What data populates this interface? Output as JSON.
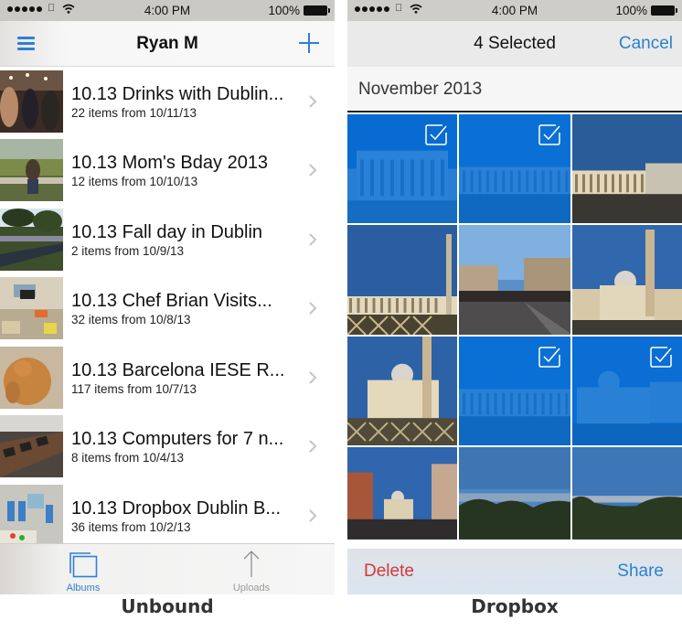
{
  "left": {
    "status_bar": {
      "time": "4:00 PM",
      "battery": "100%",
      "signal_icon": "signal-dots-icon",
      "carrier_icon": "apple-icon",
      "wifi_icon": "wifi-icon"
    },
    "nav": {
      "title": "Ryan M",
      "left_icon": "menu-icon",
      "right_icon": "plus-icon"
    },
    "albums": [
      {
        "title": "10.13 Drinks with Dublin...",
        "subtitle": "22 items from 10/11/13",
        "thumb": "people-at-bar"
      },
      {
        "title": "10.13 Mom's Bday 2013",
        "subtitle": "12 items from 10/10/13",
        "thumb": "child-on-bench"
      },
      {
        "title": "10.13 Fall day in Dublin",
        "subtitle": "2 items from 10/9/13",
        "thumb": "park-path"
      },
      {
        "title": "10.13 Chef Brian Visits...",
        "subtitle": "32 items from 10/8/13",
        "thumb": "office-lounge"
      },
      {
        "title": "10.13 Barcelona IESE R...",
        "subtitle": "117 items from 10/7/13",
        "thumb": "cat"
      },
      {
        "title": "10.13 Computers for 7 n...",
        "subtitle": "8 items from 10/4/13",
        "thumb": "laptops-on-table"
      },
      {
        "title": "10.13 Dropbox Dublin B...",
        "subtitle": "36 items from 10/2/13",
        "thumb": "group-in-office"
      }
    ],
    "tabs": [
      {
        "label": "Albums",
        "icon": "albums-icon",
        "active": true
      },
      {
        "label": "Uploads",
        "icon": "upload-arrow-icon",
        "active": false
      }
    ],
    "caption": "Unbound"
  },
  "right": {
    "status_bar": {
      "time": "4:00 PM",
      "battery": "100%"
    },
    "nav": {
      "title": "4 Selected",
      "cancel_label": "Cancel"
    },
    "section_header": "November 2013",
    "photos": [
      {
        "scene": "basilica-facade",
        "selected": true
      },
      {
        "scene": "colonnade-wide",
        "selected": true
      },
      {
        "scene": "colonnade-crowd",
        "selected": false
      },
      {
        "scene": "colonnade-fence",
        "selected": false
      },
      {
        "scene": "street-gap",
        "selected": false
      },
      {
        "scene": "basilica-obelisk",
        "selected": false
      },
      {
        "scene": "basilica-obelisk-fence",
        "selected": false
      },
      {
        "scene": "colonnade-wide",
        "selected": true
      },
      {
        "scene": "basilica-facade-2",
        "selected": true
      },
      {
        "scene": "via-conciliazione",
        "selected": false
      },
      {
        "scene": "city-view-trees",
        "selected": false
      },
      {
        "scene": "city-view-trees-2",
        "selected": false
      }
    ],
    "actions": {
      "delete_label": "Delete",
      "share_label": "Share"
    },
    "caption": "Dropbox"
  },
  "colors": {
    "accent_blue": "#2f7fd6",
    "delete_red": "#d8363c",
    "selection_blue": "#006edc"
  }
}
